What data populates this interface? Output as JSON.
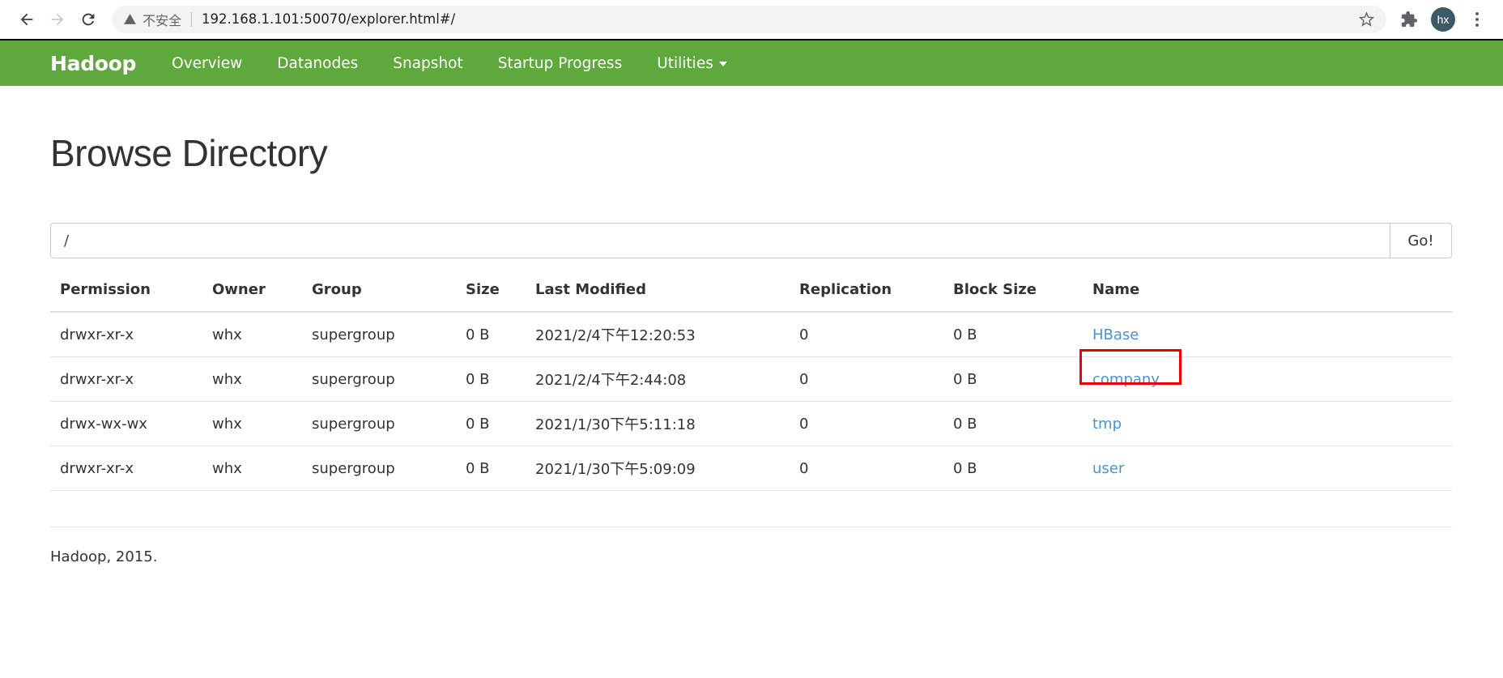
{
  "browser": {
    "back_icon": "back-arrow-icon",
    "forward_icon": "forward-arrow-icon",
    "reload_icon": "reload-icon",
    "security_warning": "不安全",
    "url": "192.168.1.101:50070/explorer.html#/",
    "star_icon": "bookmark-star-icon",
    "extensions_icon": "puzzle-piece-icon",
    "profile_initials": "hx",
    "menu_icon": "three-dot-menu-icon"
  },
  "navbar": {
    "brand": "Hadoop",
    "links": [
      {
        "label": "Overview",
        "has_caret": false
      },
      {
        "label": "Datanodes",
        "has_caret": false
      },
      {
        "label": "Snapshot",
        "has_caret": false
      },
      {
        "label": "Startup Progress",
        "has_caret": false
      },
      {
        "label": "Utilities",
        "has_caret": true
      }
    ],
    "color": "#5fa83d"
  },
  "main": {
    "title": "Browse Directory",
    "path_value": "/",
    "path_placeholder": "",
    "go_label": "Go!",
    "columns": [
      "Permission",
      "Owner",
      "Group",
      "Size",
      "Last Modified",
      "Replication",
      "Block Size",
      "Name"
    ],
    "rows": [
      {
        "permission": "drwxr-xr-x",
        "owner": "whx",
        "group": "supergroup",
        "size": "0 B",
        "last_modified": "2021/2/4下午12:20:53",
        "replication": "0",
        "block_size": "0 B",
        "name": "HBase",
        "highlighted": false
      },
      {
        "permission": "drwxr-xr-x",
        "owner": "whx",
        "group": "supergroup",
        "size": "0 B",
        "last_modified": "2021/2/4下午2:44:08",
        "replication": "0",
        "block_size": "0 B",
        "name": "company",
        "highlighted": true
      },
      {
        "permission": "drwx-wx-wx",
        "owner": "whx",
        "group": "supergroup",
        "size": "0 B",
        "last_modified": "2021/1/30下午5:11:18",
        "replication": "0",
        "block_size": "0 B",
        "name": "tmp",
        "highlighted": false
      },
      {
        "permission": "drwxr-xr-x",
        "owner": "whx",
        "group": "supergroup",
        "size": "0 B",
        "last_modified": "2021/1/30下午5:09:09",
        "replication": "0",
        "block_size": "0 B",
        "name": "user",
        "highlighted": false
      }
    ],
    "link_color": "#4a90d9",
    "annotation_color": "#ee0000"
  },
  "footer": {
    "text": "Hadoop, 2015."
  }
}
